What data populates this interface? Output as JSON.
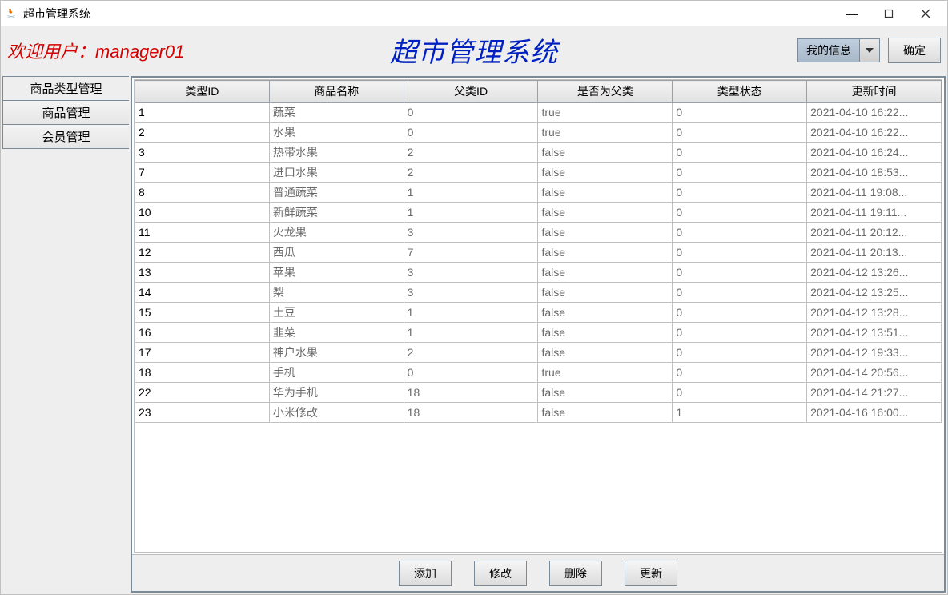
{
  "window": {
    "title": "超市管理系统"
  },
  "banner": {
    "welcome_prefix": "欢迎用户：",
    "username": "manager01",
    "app_title": "超市管理系统",
    "combo_label": "我的信息",
    "ok_button": "确定"
  },
  "tabs": [
    {
      "label": "商品类型管理",
      "active": true
    },
    {
      "label": "商品管理",
      "active": false
    },
    {
      "label": "会员管理",
      "active": false
    }
  ],
  "table": {
    "columns": [
      "类型ID",
      "商品名称",
      "父类ID",
      "是否为父类",
      "类型状态",
      "更新时间"
    ],
    "rows": [
      [
        "1",
        "蔬菜",
        "0",
        "true",
        "0",
        "2021-04-10 16:22..."
      ],
      [
        "2",
        "水果",
        "0",
        "true",
        "0",
        "2021-04-10 16:22..."
      ],
      [
        "3",
        "热带水果",
        "2",
        "false",
        "0",
        "2021-04-10 16:24..."
      ],
      [
        "7",
        "进口水果",
        "2",
        "false",
        "0",
        "2021-04-10 18:53..."
      ],
      [
        "8",
        "普通蔬菜",
        "1",
        "false",
        "0",
        "2021-04-11 19:08..."
      ],
      [
        "10",
        "新鲜蔬菜",
        "1",
        "false",
        "0",
        "2021-04-11 19:11..."
      ],
      [
        "11",
        "火龙果",
        "3",
        "false",
        "0",
        "2021-04-11 20:12..."
      ],
      [
        "12",
        "西瓜",
        "7",
        "false",
        "0",
        "2021-04-11 20:13..."
      ],
      [
        "13",
        "苹果",
        "3",
        "false",
        "0",
        "2021-04-12 13:26..."
      ],
      [
        "14",
        "梨",
        "3",
        "false",
        "0",
        "2021-04-12 13:25..."
      ],
      [
        "15",
        "土豆",
        "1",
        "false",
        "0",
        "2021-04-12 13:28..."
      ],
      [
        "16",
        "韭菜",
        "1",
        "false",
        "0",
        "2021-04-12 13:51..."
      ],
      [
        "17",
        "神户水果",
        "2",
        "false",
        "0",
        "2021-04-12 19:33..."
      ],
      [
        "18",
        "手机",
        "0",
        "true",
        "0",
        "2021-04-14 20:56..."
      ],
      [
        "22",
        "华为手机",
        "18",
        "false",
        "0",
        "2021-04-14 21:27..."
      ],
      [
        "23",
        "小米修改",
        "18",
        "false",
        "1",
        "2021-04-16 16:00..."
      ]
    ]
  },
  "buttons": {
    "add": "添加",
    "edit": "修改",
    "delete": "删除",
    "refresh": "更新"
  }
}
